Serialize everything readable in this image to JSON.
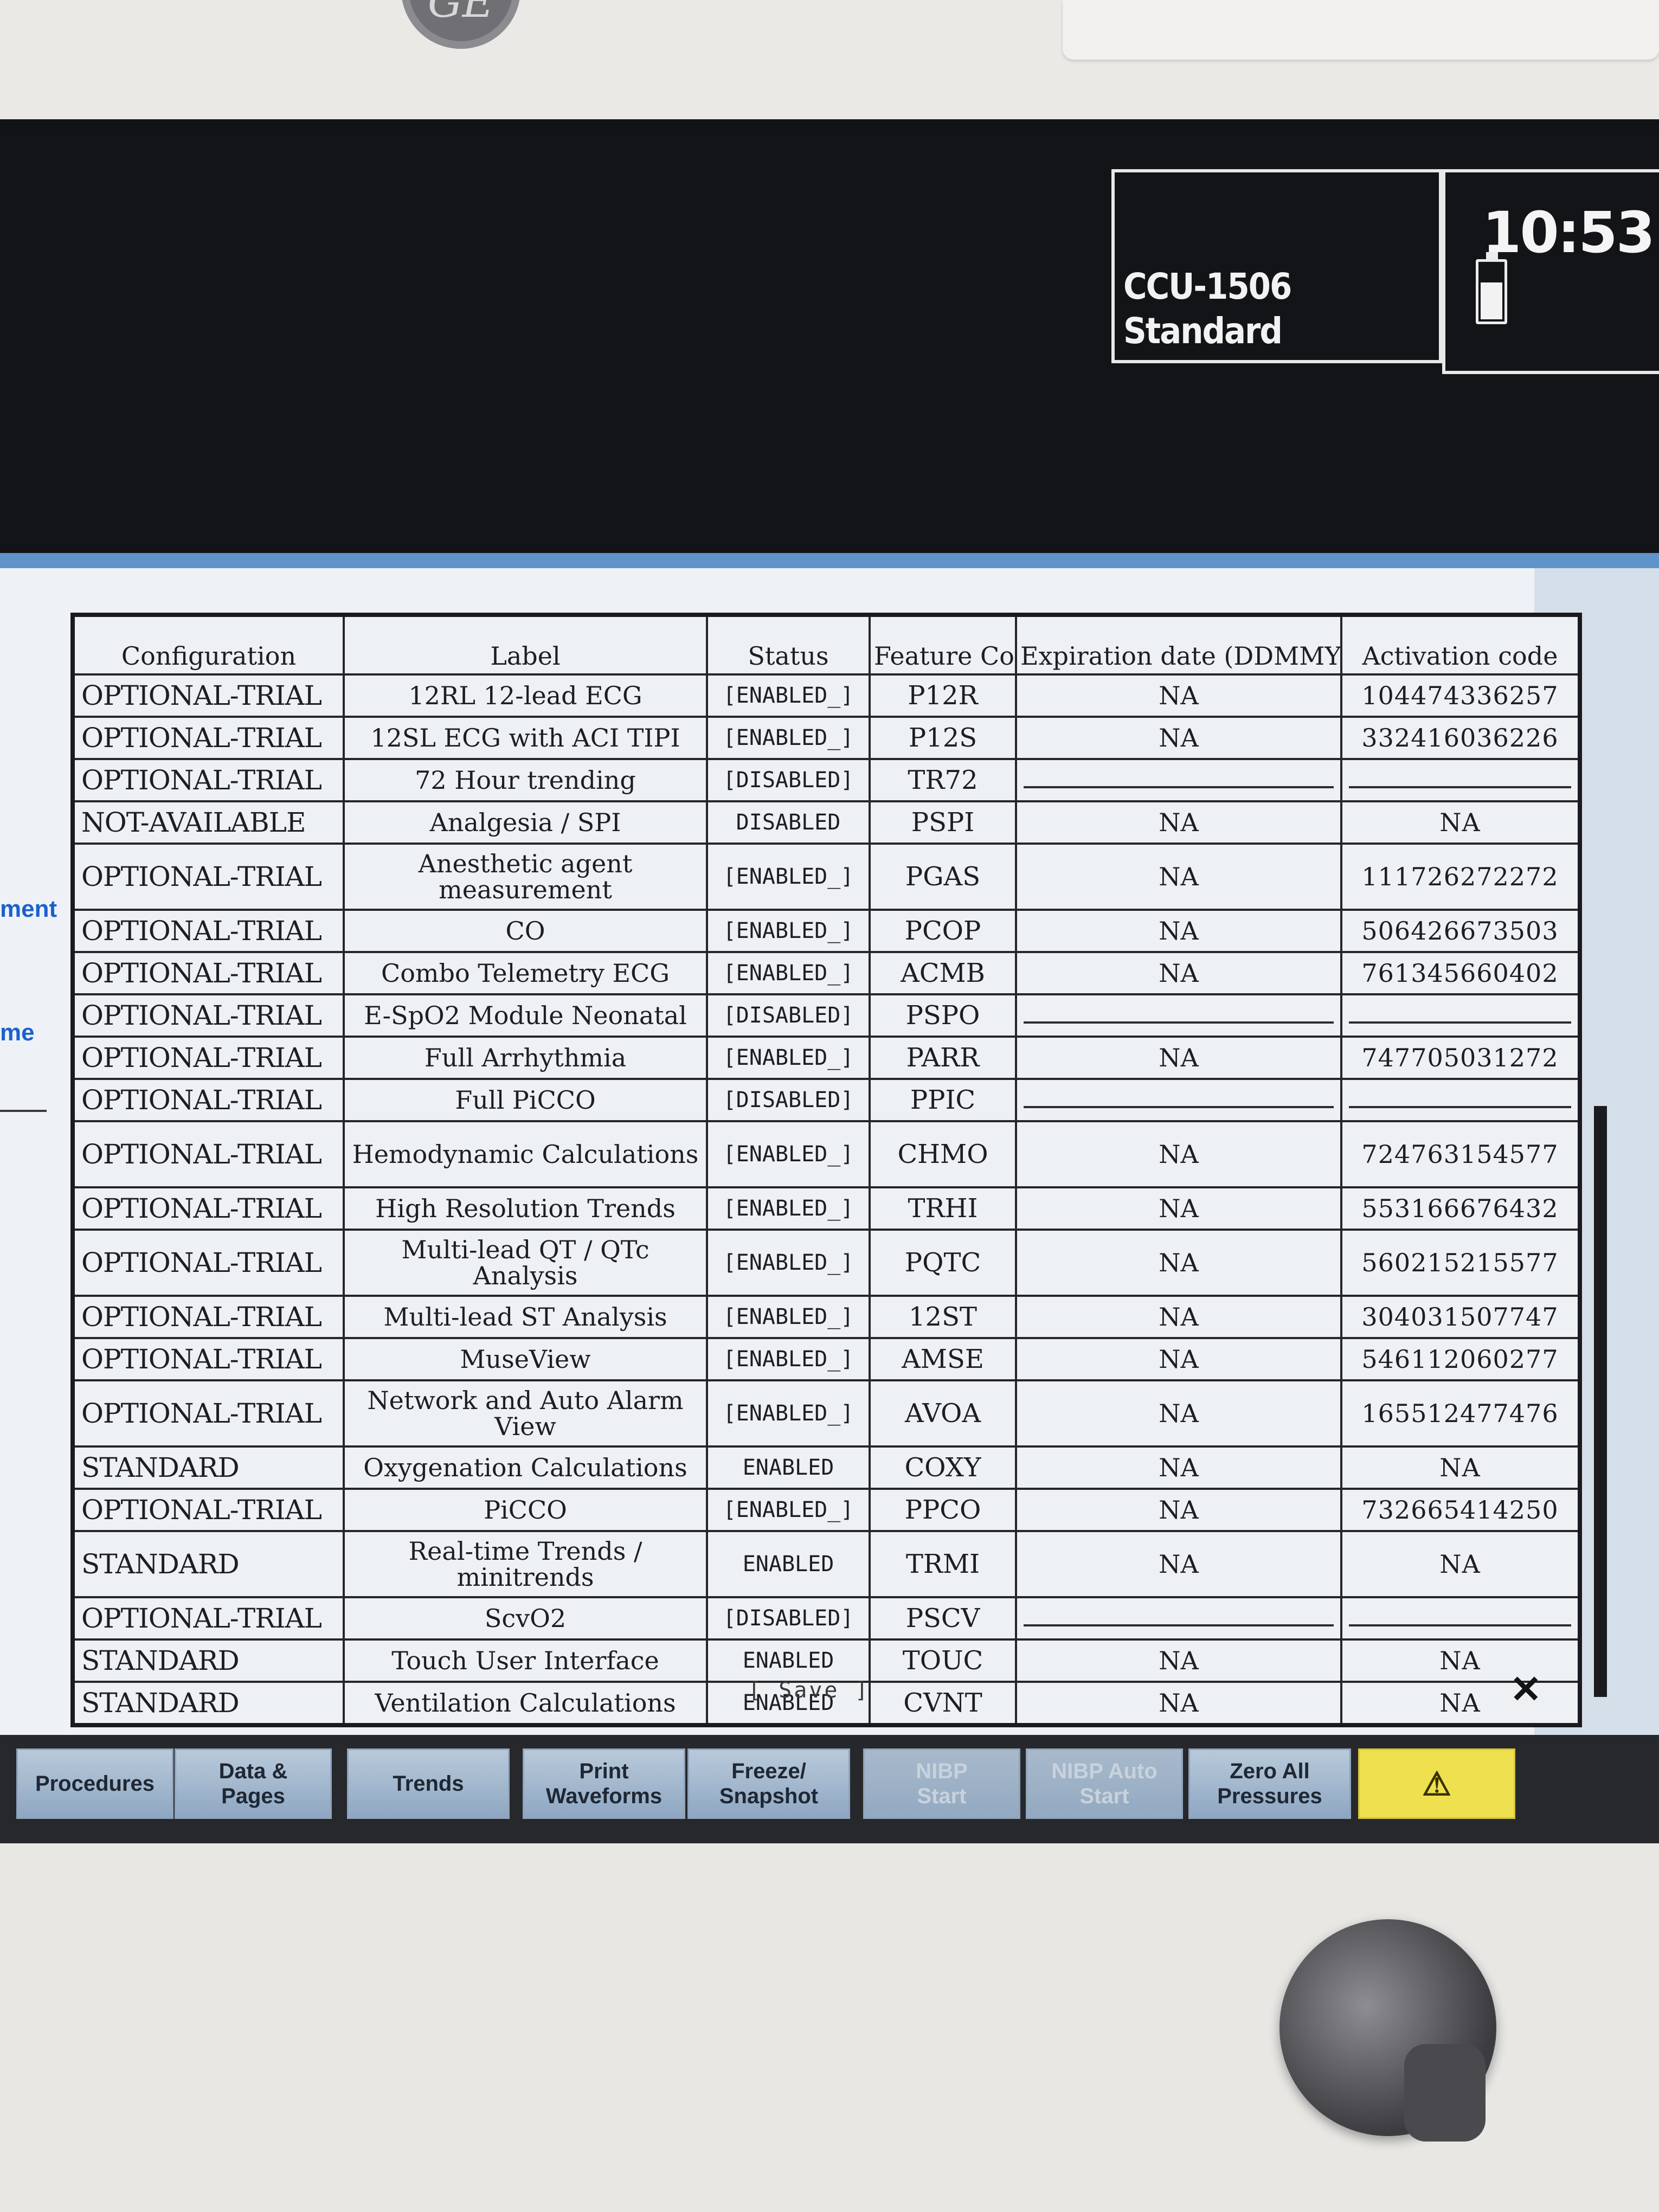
{
  "header": {
    "unit_name": "CCU-1506",
    "profile": "Standard",
    "time": "10:53"
  },
  "side_labels": [
    "ment",
    "me"
  ],
  "table": {
    "columns": [
      "Configuration",
      "Label",
      "Status",
      "Feature Code",
      "Expiration date (DDMMYYYY)",
      "Activation code"
    ],
    "rows": [
      {
        "config": "OPTIONAL-TRIAL",
        "label": "12RL 12-lead ECG",
        "status": "[ENABLED_]",
        "code": "P12R",
        "expiry": "NA",
        "activation": "104474336257"
      },
      {
        "config": "OPTIONAL-TRIAL",
        "label": "12SL ECG with ACI TIPI",
        "status": "[ENABLED_]",
        "code": "P12S",
        "expiry": "NA",
        "activation": "332416036226"
      },
      {
        "config": "OPTIONAL-TRIAL",
        "label": "72 Hour trending",
        "status": "[DISABLED]",
        "code": "TR72",
        "expiry": "",
        "activation": ""
      },
      {
        "config": "NOT-AVAILABLE",
        "label": "Analgesia / SPI",
        "status": "DISABLED",
        "code": "PSPI",
        "expiry": "NA",
        "activation": "NA"
      },
      {
        "config": "OPTIONAL-TRIAL",
        "label": "Anesthetic agent measurement",
        "status": "[ENABLED_]",
        "code": "PGAS",
        "expiry": "NA",
        "activation": "111726272272",
        "tall": true
      },
      {
        "config": "OPTIONAL-TRIAL",
        "label": "CO",
        "status": "[ENABLED_]",
        "code": "PCOP",
        "expiry": "NA",
        "activation": "506426673503"
      },
      {
        "config": "OPTIONAL-TRIAL",
        "label": "Combo Telemetry ECG",
        "status": "[ENABLED_]",
        "code": "ACMB",
        "expiry": "NA",
        "activation": "761345660402"
      },
      {
        "config": "OPTIONAL-TRIAL",
        "label": "E-SpO2 Module Neonatal",
        "status": "[DISABLED]",
        "code": "PSPO",
        "expiry": "",
        "activation": ""
      },
      {
        "config": "OPTIONAL-TRIAL",
        "label": "Full Arrhythmia",
        "status": "[ENABLED_]",
        "code": "PARR",
        "expiry": "NA",
        "activation": "747705031272"
      },
      {
        "config": "OPTIONAL-TRIAL",
        "label": "Full PiCCO",
        "status": "[DISABLED]",
        "code": "PPIC",
        "expiry": "",
        "activation": ""
      },
      {
        "config": "OPTIONAL-TRIAL",
        "label": "Hemodynamic Calculations",
        "status": "[ENABLED_]",
        "code": "CHMO",
        "expiry": "NA",
        "activation": "724763154577",
        "tall": true
      },
      {
        "config": "OPTIONAL-TRIAL",
        "label": "High Resolution Trends",
        "status": "[ENABLED_]",
        "code": "TRHI",
        "expiry": "NA",
        "activation": "553166676432"
      },
      {
        "config": "OPTIONAL-TRIAL",
        "label": "Multi-lead QT / QTc Analysis",
        "status": "[ENABLED_]",
        "code": "PQTC",
        "expiry": "NA",
        "activation": "560215215577",
        "tall": true
      },
      {
        "config": "OPTIONAL-TRIAL",
        "label": "Multi-lead ST Analysis",
        "status": "[ENABLED_]",
        "code": "12ST",
        "expiry": "NA",
        "activation": "304031507747"
      },
      {
        "config": "OPTIONAL-TRIAL",
        "label": "MuseView",
        "status": "[ENABLED_]",
        "code": "AMSE",
        "expiry": "NA",
        "activation": "546112060277"
      },
      {
        "config": "OPTIONAL-TRIAL",
        "label": "Network and Auto Alarm View",
        "status": "[ENABLED_]",
        "code": "AVOA",
        "expiry": "NA",
        "activation": "165512477476",
        "tall": true
      },
      {
        "config": "STANDARD",
        "label": "Oxygenation Calculations",
        "status": "ENABLED",
        "code": "COXY",
        "expiry": "NA",
        "activation": "NA"
      },
      {
        "config": "OPTIONAL-TRIAL",
        "label": "PiCCO",
        "status": "[ENABLED_]",
        "code": "PPCO",
        "expiry": "NA",
        "activation": "732665414250"
      },
      {
        "config": "STANDARD",
        "label": "Real-time Trends / minitrends",
        "status": "ENABLED",
        "code": "TRMI",
        "expiry": "NA",
        "activation": "NA",
        "tall": true
      },
      {
        "config": "OPTIONAL-TRIAL",
        "label": "ScvO2",
        "status": "[DISABLED]",
        "code": "PSCV",
        "expiry": "",
        "activation": ""
      },
      {
        "config": "STANDARD",
        "label": "Touch User Interface",
        "status": "ENABLED",
        "code": "TOUC",
        "expiry": "NA",
        "activation": "NA"
      },
      {
        "config": "STANDARD",
        "label": "Ventilation Calculations",
        "status": "ENABLED",
        "code": "CVNT",
        "expiry": "NA",
        "activation": "NA"
      }
    ]
  },
  "save_label": "[ Save ]",
  "close_label": "✕",
  "buttons": [
    {
      "name": "procedures-button",
      "label": "Procedures",
      "enabled": true
    },
    {
      "name": "data-pages-button",
      "label": "Data &\nPages",
      "enabled": true
    },
    {
      "name": "trends-button",
      "label": "Trends",
      "enabled": true
    },
    {
      "name": "print-waveforms-button",
      "label": "Print\nWaveforms",
      "enabled": true
    },
    {
      "name": "freeze-snapshot-button",
      "label": "Freeze/\nSnapshot",
      "enabled": true
    },
    {
      "name": "nibp-start-button",
      "label": "NIBP\nStart",
      "enabled": false
    },
    {
      "name": "nibp-auto-start-button",
      "label": "NIBP Auto\nStart",
      "enabled": false
    },
    {
      "name": "zero-all-pressures-button",
      "label": "Zero All\nPressures",
      "enabled": true
    }
  ],
  "alarm_icon": "alarm-bell-icon",
  "colors": {
    "window_title": "#5f93c9",
    "alarm_button": "#efe050",
    "side_label": "#1c60cf"
  }
}
